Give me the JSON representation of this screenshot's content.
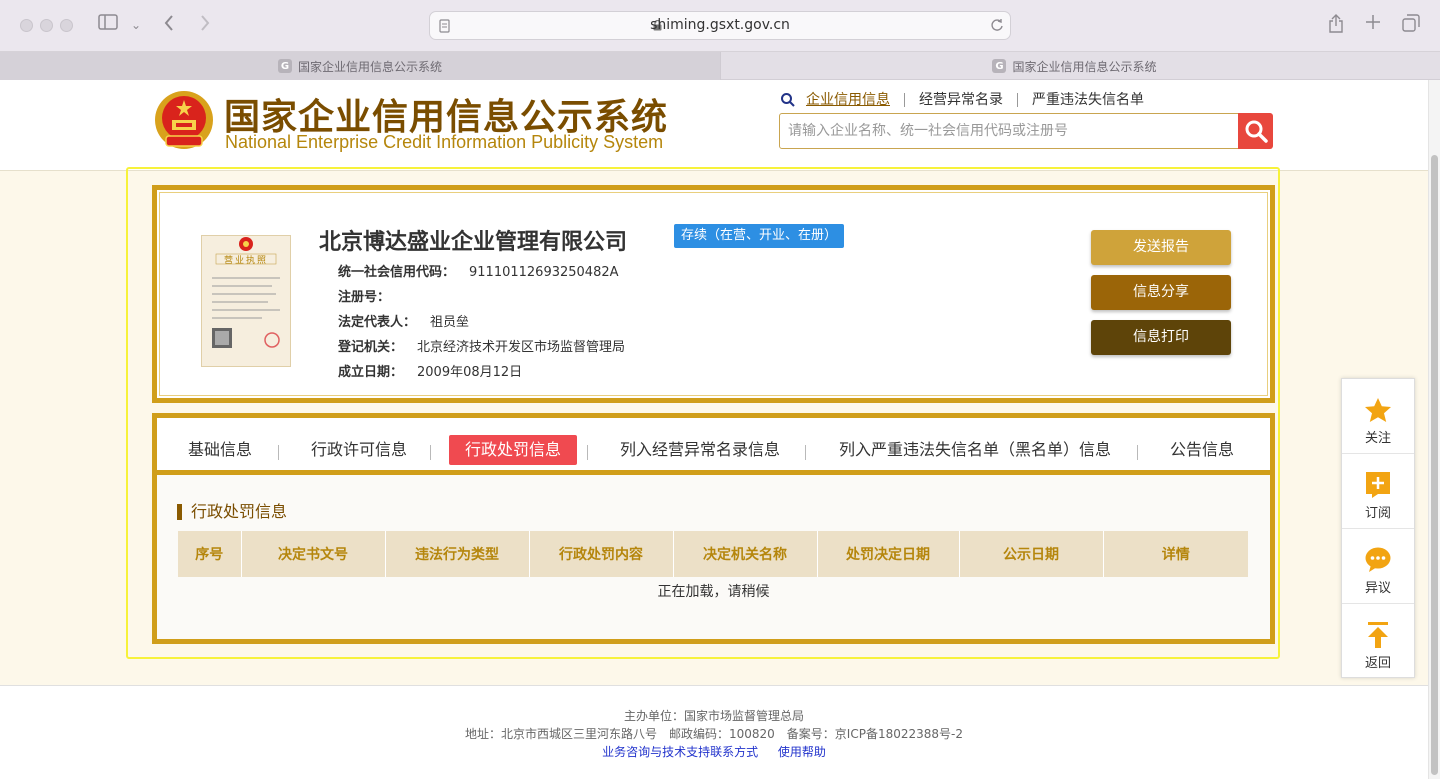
{
  "browser": {
    "url": "shiming.gsxt.gov.cn",
    "tabs": [
      {
        "label": "国家企业信用信息公示系统",
        "favicon": "G"
      },
      {
        "label": "国家企业信用信息公示系统",
        "favicon": "G"
      }
    ]
  },
  "header": {
    "title_cn": "国家企业信用信息公示系统",
    "title_en": "National Enterprise Credit Information Publicity System",
    "nav": [
      "企业信用信息",
      "经营异常名录",
      "严重违法失信名单"
    ],
    "search_placeholder": "请输入企业名称、统一社会信用代码或注册号"
  },
  "company": {
    "license_title": "营业执照",
    "name": "北京博达盛业企业管理有限公司",
    "status": "存续（在营、开业、在册）",
    "fields": [
      {
        "label": "统一社会信用代码：",
        "value": "91110112693250482A"
      },
      {
        "label": "注册号：",
        "value": ""
      },
      {
        "label": "法定代表人：",
        "value": "祖员垒"
      },
      {
        "label": "登记机关：",
        "value": "北京经济技术开发区市场监督管理局"
      },
      {
        "label": "成立日期：",
        "value": "2009年08月12日"
      }
    ],
    "actions": [
      "发送报告",
      "信息分享",
      "信息打印"
    ]
  },
  "tabs": [
    "基础信息",
    "行政许可信息",
    "行政处罚信息",
    "列入经营异常名录信息",
    "列入严重违法失信名单（黑名单）信息",
    "公告信息"
  ],
  "active_tab": "行政处罚信息",
  "section": {
    "title": "行政处罚信息",
    "columns": [
      "序号",
      "决定书文号",
      "违法行为类型",
      "行政处罚内容",
      "决定机关名称",
      "处罚决定日期",
      "公示日期",
      "详情"
    ],
    "loading_text": "正在加载，请稍候"
  },
  "side_bar": [
    "关注",
    "订阅",
    "异议",
    "返回"
  ],
  "footer": {
    "sponsor": "主办单位：国家市场监督管理总局",
    "address": "地址：北京市西城区三里河东路八号　邮政编码：100820　备案号：京ICP备18022388号-2",
    "links": [
      "业务咨询与技术支持联系方式",
      "使用帮助"
    ]
  },
  "colors": {
    "brand_gold": "#d09e1a",
    "brand_brown": "#7a4d00",
    "active_tab": "#f04a50",
    "status_blue": "#2d8fe3",
    "btn_send": "#cfa33a",
    "btn_share": "#9b6508",
    "btn_print": "#5e4409"
  }
}
